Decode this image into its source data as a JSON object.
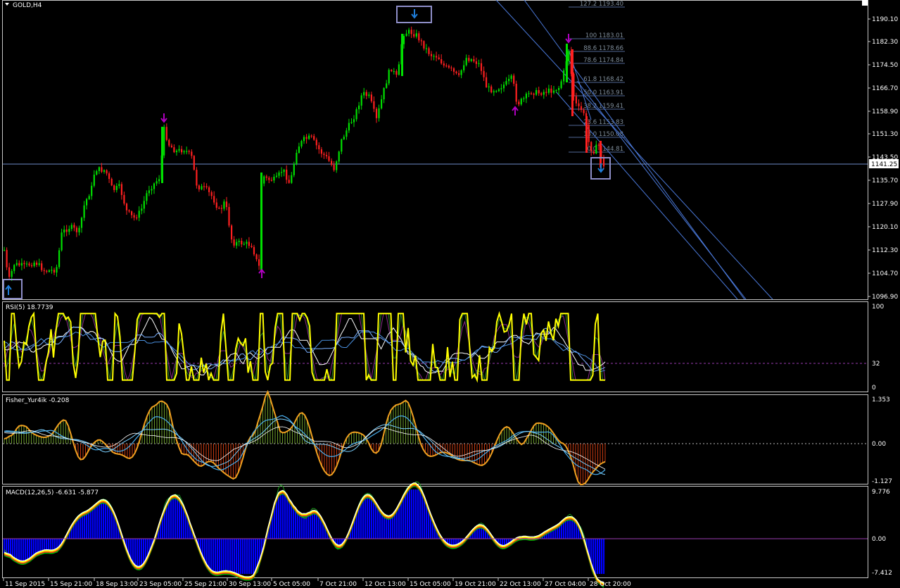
{
  "window": {
    "symbol_label": "GOLD,H4"
  },
  "price_chart": {
    "price_ticks": [
      "1190.10",
      "1182.30",
      "1174.50",
      "1166.70",
      "1158.90",
      "1151.30",
      "1143.50",
      "1135.70",
      "1127.90",
      "1120.10",
      "1112.30",
      "1104.70",
      "1096.90"
    ],
    "current_price": "1141.25",
    "fib_levels": [
      {
        "label": "127.2 1193.40"
      },
      {
        "label": "100 1183.01"
      },
      {
        "label": "88.6 1178.66"
      },
      {
        "label": "78.6 1174.84"
      },
      {
        "label": "61.8 1168.42"
      },
      {
        "label": "50.0 1163.91"
      },
      {
        "label": "38.2 1159.41"
      },
      {
        "label": "23.6 1153.83"
      },
      {
        "label": "13.0 1150.08"
      },
      {
        "label": "0.0 1144.81"
      }
    ]
  },
  "rsi": {
    "title": "RSI(5) 18.7739",
    "ticks": [
      "100",
      "32",
      "0"
    ]
  },
  "fisher": {
    "title": "Fisher_Yur4ik -0.208",
    "ticks": [
      "1.353",
      "0.00",
      "-1.127"
    ]
  },
  "macd": {
    "title": "MACD(12,26,5) -6.631 -5.877",
    "ticks": [
      "9.776",
      "0.00",
      "-7.412"
    ]
  },
  "time_axis": [
    "11 Sep 2015",
    "15 Sep 21:00",
    "18 Sep 13:00",
    "23 Sep 05:00",
    "25 Sep 21:00",
    "30 Sep 13:00",
    "5 Oct 05:00",
    "7 Oct 21:00",
    "12 Oct 13:00",
    "15 Oct 05:00",
    "19 Oct 21:00",
    "22 Oct 13:00",
    "27 Oct 04:00",
    "28 Oct 20:00"
  ],
  "colors": {
    "bull": "#00e000",
    "bear": "#ff2020",
    "grid": "#6e8cc8",
    "arrow_up": "#b000c0",
    "arrow_down": "#1e7cd8",
    "rsi": "#ffff00",
    "macd_hist": "#0000ff"
  }
}
